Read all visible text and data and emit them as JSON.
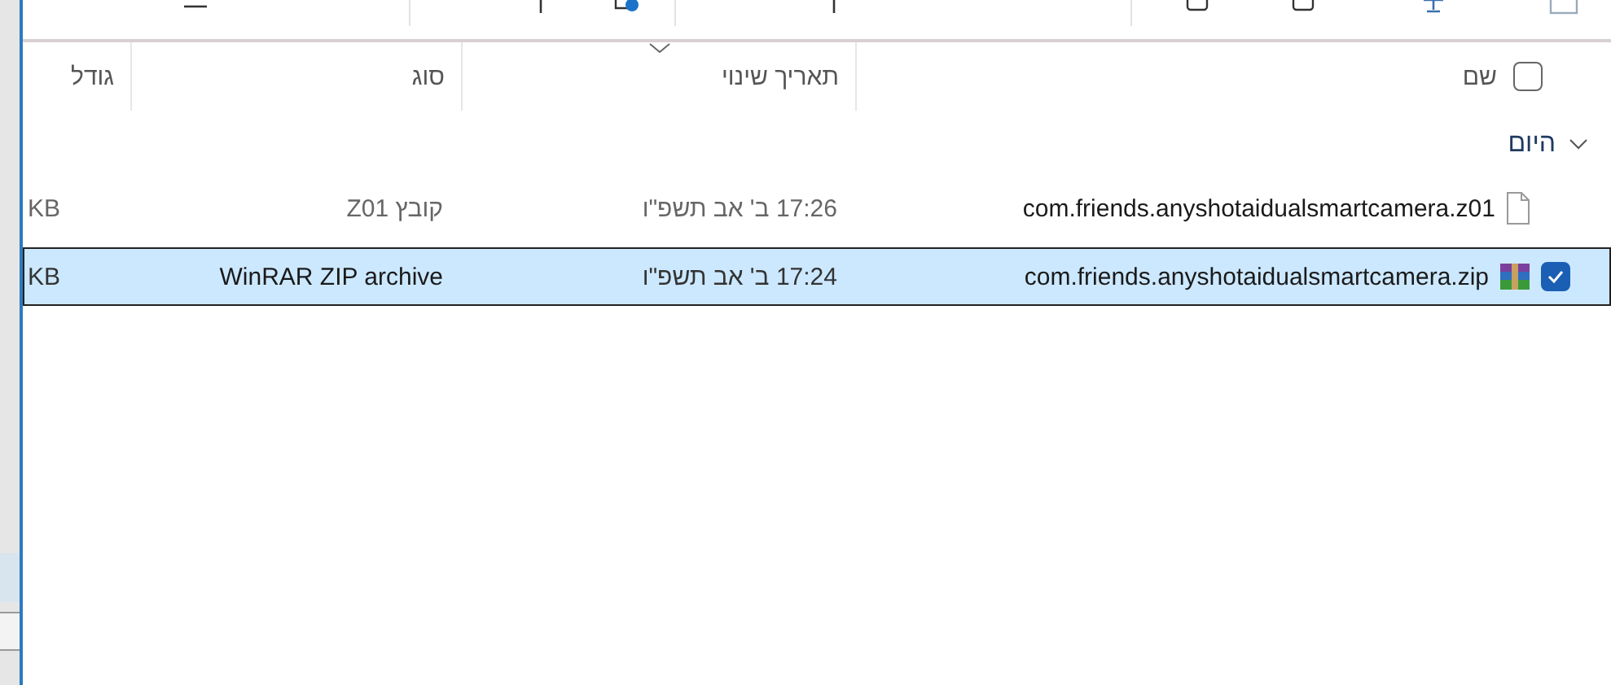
{
  "header": {
    "select_all": {
      "checked": false
    },
    "columns": [
      {
        "label": "שם",
        "sorted": false
      },
      {
        "label": "תאריך שינוי",
        "sorted": true
      },
      {
        "label": "סוג",
        "sorted": false
      },
      {
        "label": "גודל",
        "sorted": false
      }
    ]
  },
  "group": {
    "label": "היום",
    "expanded": true
  },
  "rows": [
    {
      "kind": "file",
      "name": "com.friends.anyshotaidualsmartcamera.z01",
      "date": "17:26 ב' אב תשפ\"ו",
      "type": "קובץ Z01",
      "size": "KB",
      "selected": false
    },
    {
      "kind": "archive",
      "name": "com.friends.anyshotaidualsmartcamera.zip",
      "date": "17:24 ב' אב תשפ\"ו",
      "type": "WinRAR ZIP archive",
      "size": "KB",
      "selected": true
    }
  ]
}
